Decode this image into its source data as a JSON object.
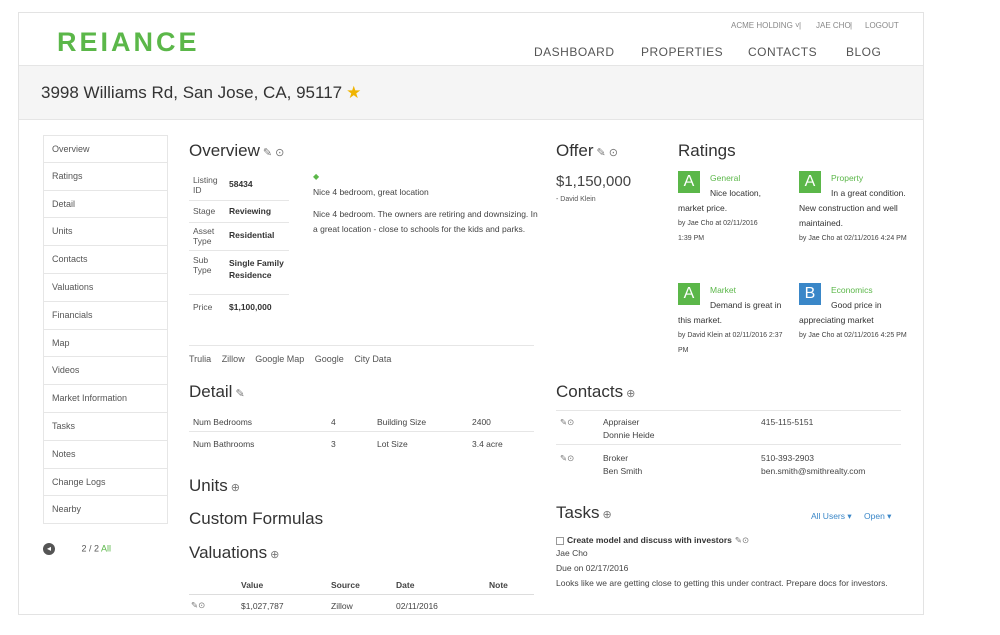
{
  "header": {
    "logo": "REIANCE",
    "org": "ACME HOLDING ˅",
    "user": "JAE CHO",
    "logout": "LOGOUT",
    "nav": [
      "DASHBOARD",
      "PROPERTIES",
      "CONTACTS",
      "BLOG"
    ]
  },
  "property": {
    "address": "3998 Williams Rd, San Jose, CA, 95117"
  },
  "sidebar": {
    "items": [
      "Overview",
      "Ratings",
      "Detail",
      "Units",
      "Contacts",
      "Valuations",
      "Financials",
      "Map",
      "Videos",
      "Market Information",
      "Tasks",
      "Notes",
      "Change Logs",
      "Nearby"
    ],
    "pager_text": "2 / 2",
    "pager_link": "All"
  },
  "overview": {
    "title": "Overview",
    "fields": [
      {
        "label": "Listing ID",
        "value": "58434"
      },
      {
        "label": "Stage",
        "value": "Reviewing"
      },
      {
        "label": "Asset Type",
        "value": "Residential"
      },
      {
        "label": "Sub Type",
        "value": "Single Family Residence"
      },
      {
        "label": "Price",
        "value": "$1,100,000"
      }
    ],
    "summary": "Nice 4 bedroom, great location",
    "description": "Nice 4 bedroom. The owners are retiring and downsizing. In a great location - close to schools for the kids and parks.",
    "links": [
      "Trulia",
      "Zillow",
      "Google Map",
      "Google",
      "City Data"
    ]
  },
  "detail": {
    "title": "Detail",
    "rows": [
      {
        "l1": "Num Bedrooms",
        "v1": "4",
        "l2": "Building Size",
        "v2": "2400"
      },
      {
        "l1": "Num Bathrooms",
        "v1": "3",
        "l2": "Lot Size",
        "v2": "3.4 acre"
      }
    ]
  },
  "sections": {
    "units": "Units",
    "custom": "Custom Formulas",
    "valuations": "Valuations"
  },
  "valuations": {
    "columns": [
      "Value",
      "Source",
      "Date",
      "Note"
    ],
    "rows": [
      {
        "value": "$1,027,787",
        "source": "Zillow",
        "date": "02/11/2016",
        "note": ""
      }
    ]
  },
  "offer": {
    "title": "Offer",
    "amount": "$1,150,000",
    "by": "- David Klein"
  },
  "ratings": {
    "title": "Ratings",
    "items": [
      {
        "grade": "A",
        "category": "General",
        "text": "Nice location, market price.",
        "by": "by Jae Cho at 02/11/2016 1:39 PM",
        "color": "#5bb749"
      },
      {
        "grade": "A",
        "category": "Property",
        "text": "In a great condition. New construction and well maintained.",
        "by": "by Jae Cho at 02/11/2016 4:24 PM",
        "color": "#5bb749"
      },
      {
        "grade": "A",
        "category": "Market",
        "text": "Demand is great in this market.",
        "by": "by David Klein at 02/11/2016 2:37 PM",
        "color": "#5bb749"
      },
      {
        "grade": "B",
        "category": "Economics",
        "text": "Good price in appreciating market",
        "by": "by Jae Cho at 02/11/2016 4:25 PM",
        "color": "#3a87c8"
      }
    ]
  },
  "contacts": {
    "title": "Contacts",
    "items": [
      {
        "role": "Appraiser",
        "name": "Donnie Heide",
        "phone": "415-115-5151",
        "email": ""
      },
      {
        "role": "Broker",
        "name": "Ben Smith",
        "phone": "510-393-2903",
        "email": "ben.smith@smithrealty.com"
      }
    ]
  },
  "tasks": {
    "title": "Tasks",
    "filter_users": "All Users ▾",
    "filter_status": "Open ▾",
    "item": {
      "title": "Create model and discuss with investors",
      "assignee": "Jae Cho",
      "due": "Due on 02/17/2016",
      "note": "Looks like we are getting close to getting this under contract. Prepare docs for investors."
    }
  },
  "colors": {
    "brand": "#5bb749",
    "link_blue": "#3a87c8",
    "star": "#f0b400"
  }
}
